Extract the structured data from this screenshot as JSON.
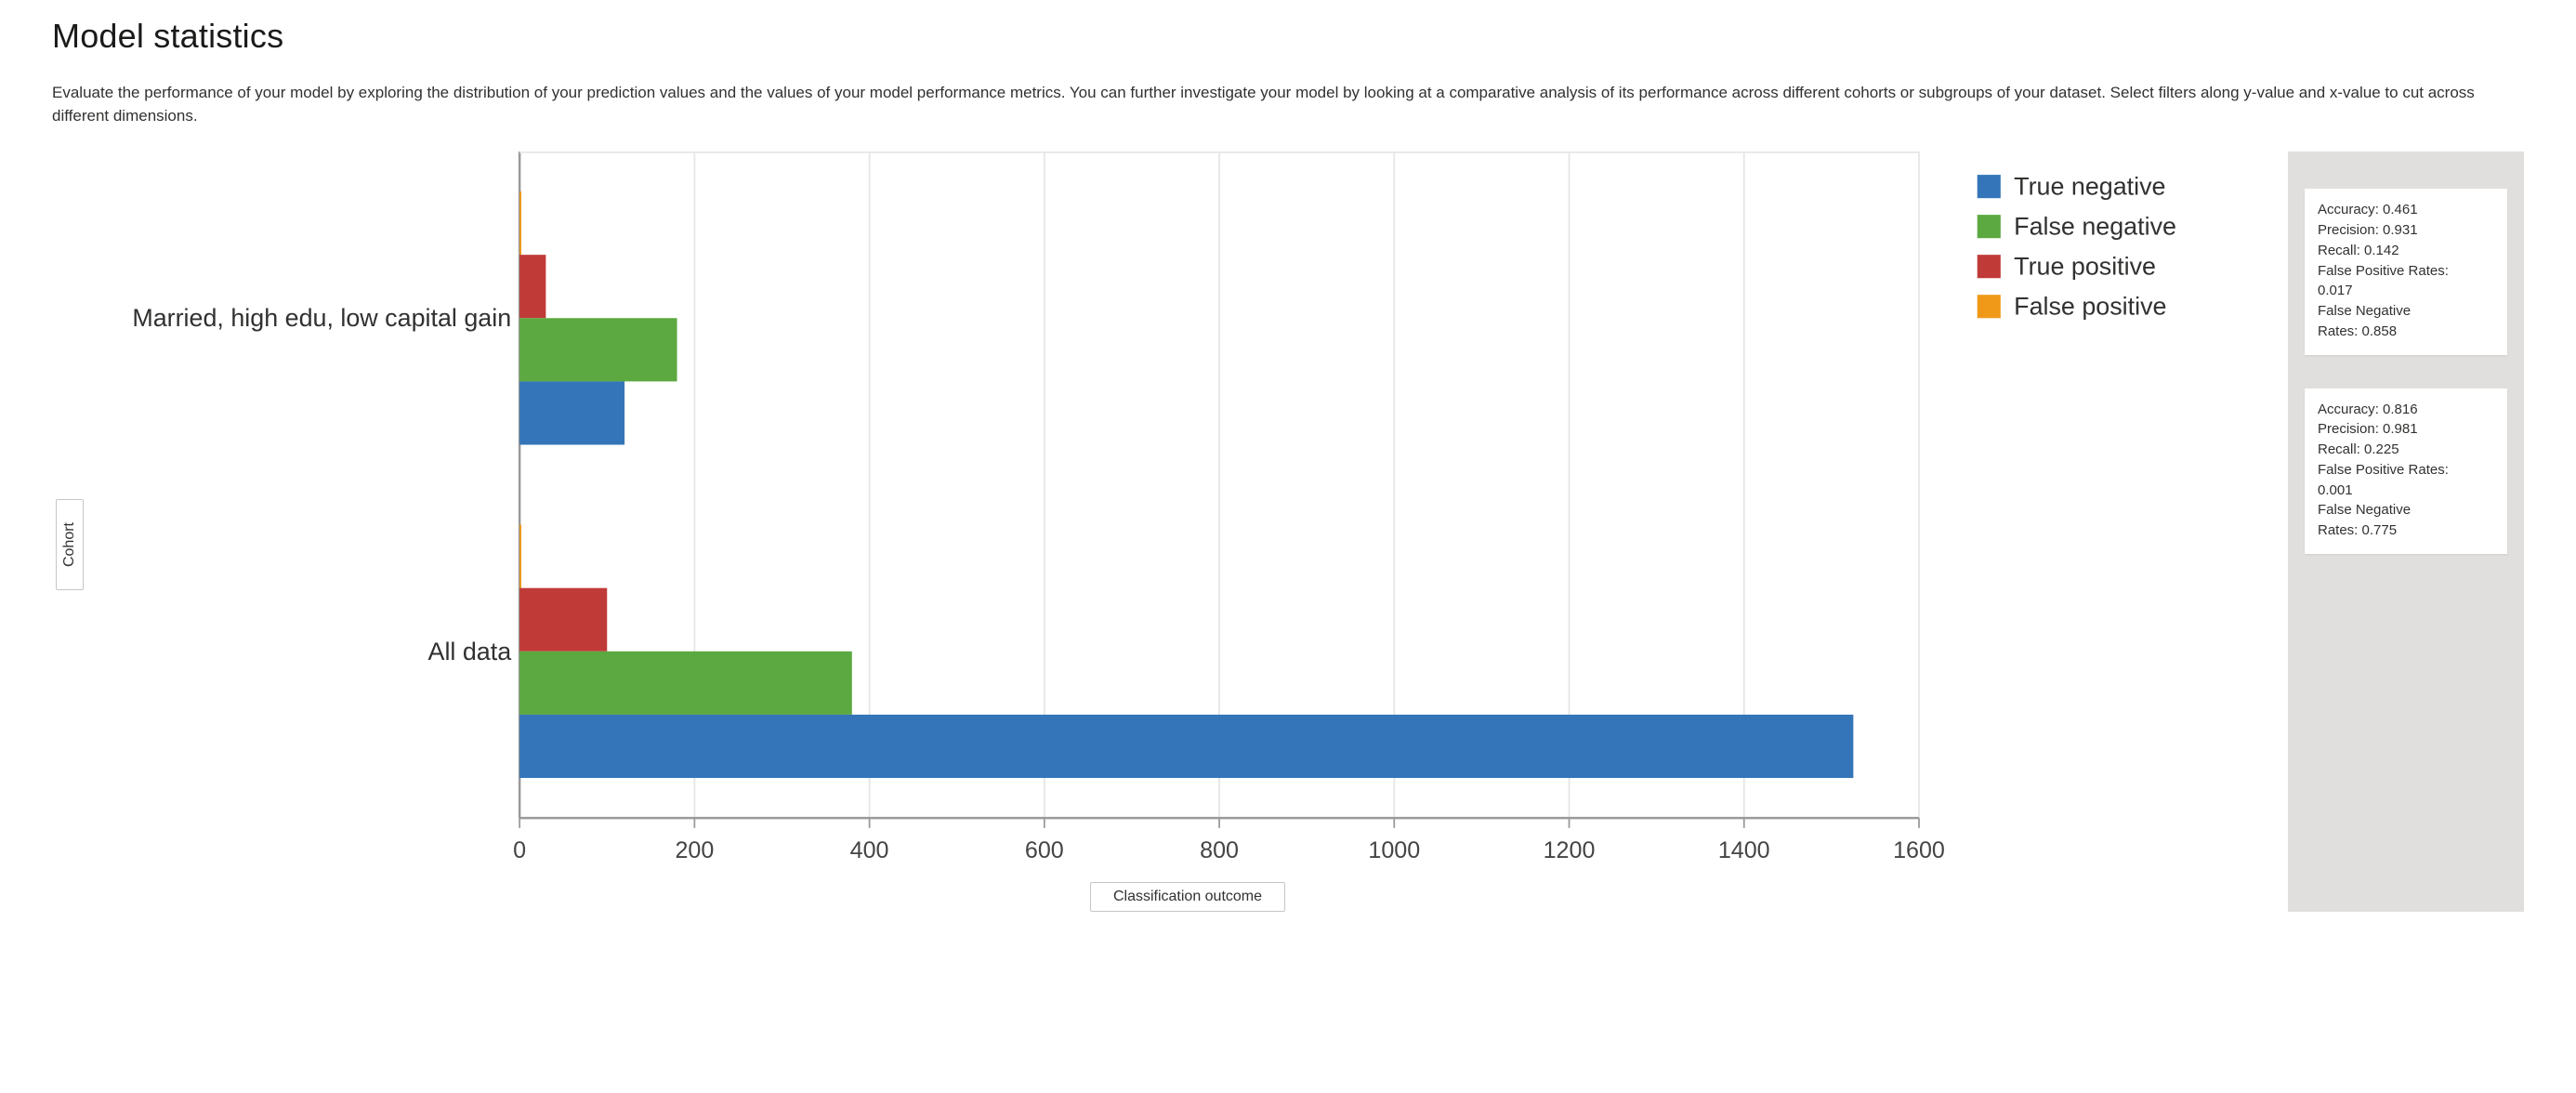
{
  "header": {
    "title": "Model statistics",
    "description": "Evaluate the performance of your model by exploring the distribution of your prediction values and the values of your model performance metrics. You can further investigate your model by looking at a comparative analysis of its performance across different cohorts or subgroups of your dataset. Select filters along y-value and x-value to cut across different dimensions."
  },
  "axis_labels": {
    "y_label": "Cohort",
    "x_label": "Classification outcome"
  },
  "legend": {
    "true_negative": "True negative",
    "false_negative": "False negative",
    "true_positive": "True positive",
    "false_positive": "False positive"
  },
  "colors": {
    "true_negative": "#3375b8",
    "false_negative": "#5ba940",
    "true_positive": "#c03a38",
    "false_positive": "#f09919",
    "gridline": "#e6e6e6",
    "baseline": "#9a9a9a"
  },
  "tick_labels": {
    "0": "0",
    "200": "200",
    "400": "400",
    "600": "600",
    "800": "800",
    "1000": "1000",
    "1200": "1200",
    "1400": "1400",
    "1600": "1600"
  },
  "category_labels": {
    "married": "Married, high edu, low capital gain",
    "all": "All data"
  },
  "stats_labels": {
    "accuracy": "Accuracy",
    "precision": "Precision",
    "recall": "Recall",
    "fpr_line": "False Positive Rates:",
    "fnr_line": "False Negative Rates:"
  },
  "stats_cards": [
    {
      "accuracy": "0.461",
      "precision": "0.931",
      "recall": "0.142",
      "fpr": "0.017",
      "fnr": "0.858"
    },
    {
      "accuracy": "0.816",
      "precision": "0.981",
      "recall": "0.225",
      "fpr": "0.001",
      "fnr": "0.775"
    }
  ],
  "chart_data": {
    "type": "bar",
    "orientation": "horizontal",
    "xlabel": "Classification outcome",
    "ylabel": "Cohort",
    "xlim": [
      0,
      1600
    ],
    "x_ticks": [
      0,
      200,
      400,
      600,
      800,
      1000,
      1200,
      1400,
      1600
    ],
    "categories": [
      "Married, high edu, low capital gain",
      "All data"
    ],
    "series": [
      {
        "name": "False positive",
        "color": "#f09919",
        "values": [
          2,
          2
        ]
      },
      {
        "name": "True positive",
        "color": "#c03a38",
        "values": [
          30,
          100
        ]
      },
      {
        "name": "False negative",
        "color": "#5ba940",
        "values": [
          180,
          380
        ]
      },
      {
        "name": "True negative",
        "color": "#3375b8",
        "values": [
          120,
          1525
        ]
      }
    ],
    "legend_order": [
      "True negative",
      "False negative",
      "True positive",
      "False positive"
    ]
  }
}
